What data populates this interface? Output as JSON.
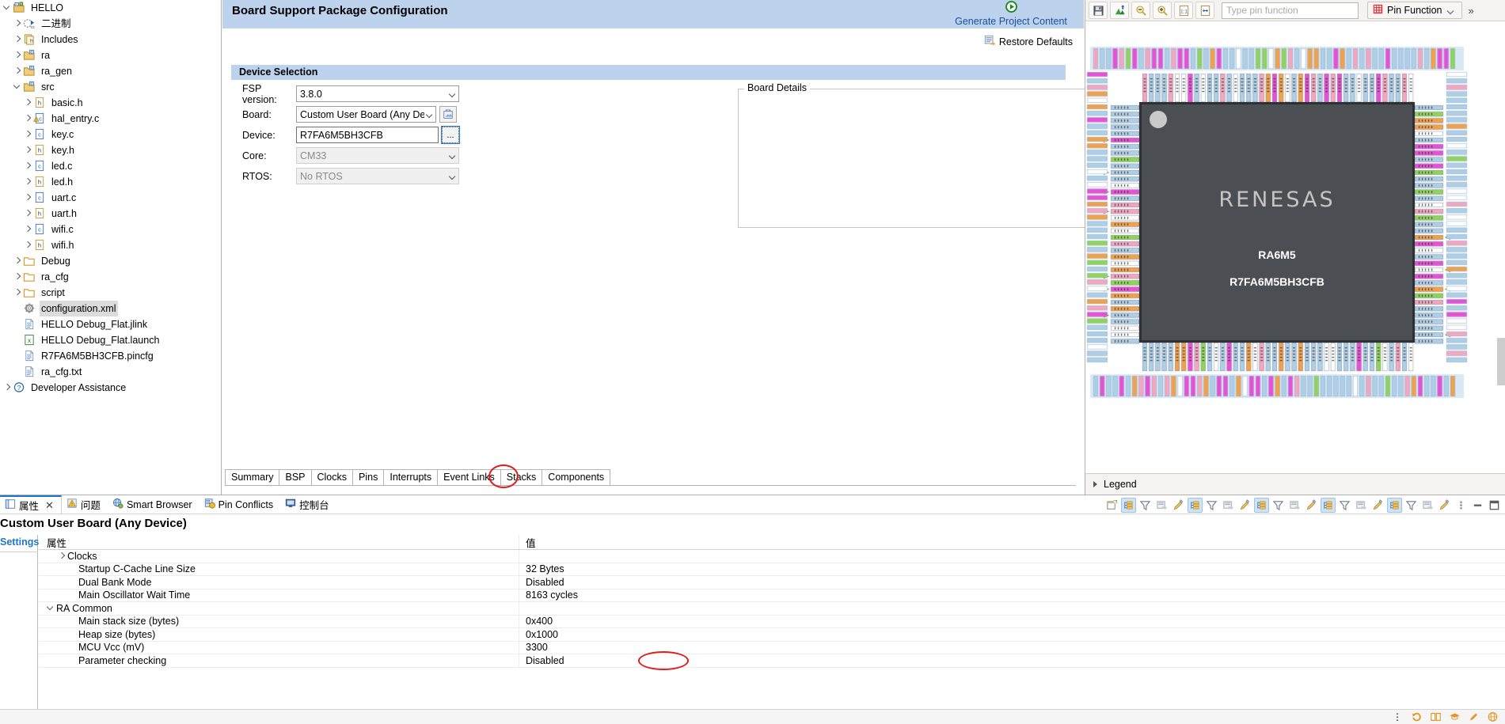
{
  "explorer": {
    "items": [
      {
        "label": "HELLO",
        "depth": 0,
        "arrow": "open",
        "icon": "project-icon",
        "selected": false
      },
      {
        "label": "二进制",
        "depth": 1,
        "arrow": "closed",
        "icon": "binaries-icon",
        "selected": false
      },
      {
        "label": "Includes",
        "depth": 1,
        "arrow": "closed",
        "icon": "includes-icon",
        "selected": false
      },
      {
        "label": "ra",
        "depth": 1,
        "arrow": "closed",
        "icon": "source-folder-icon",
        "selected": false
      },
      {
        "label": "ra_gen",
        "depth": 1,
        "arrow": "closed",
        "icon": "source-folder-icon",
        "selected": false
      },
      {
        "label": "src",
        "depth": 1,
        "arrow": "open",
        "icon": "source-folder-icon",
        "selected": false
      },
      {
        "label": "basic.h",
        "depth": 2,
        "arrow": "closed",
        "icon": "header-file-icon",
        "selected": false
      },
      {
        "label": "hal_entry.c",
        "depth": 2,
        "arrow": "closed",
        "icon": "c-file-warning-icon",
        "selected": false
      },
      {
        "label": "key.c",
        "depth": 2,
        "arrow": "closed",
        "icon": "c-file-icon",
        "selected": false
      },
      {
        "label": "key.h",
        "depth": 2,
        "arrow": "closed",
        "icon": "header-file-icon",
        "selected": false
      },
      {
        "label": "led.c",
        "depth": 2,
        "arrow": "closed",
        "icon": "c-file-icon",
        "selected": false
      },
      {
        "label": "led.h",
        "depth": 2,
        "arrow": "closed",
        "icon": "header-file-icon",
        "selected": false
      },
      {
        "label": "uart.c",
        "depth": 2,
        "arrow": "closed",
        "icon": "c-file-icon",
        "selected": false
      },
      {
        "label": "uart.h",
        "depth": 2,
        "arrow": "closed",
        "icon": "header-file-icon",
        "selected": false
      },
      {
        "label": "wifi.c",
        "depth": 2,
        "arrow": "closed",
        "icon": "c-file-icon",
        "selected": false
      },
      {
        "label": "wifi.h",
        "depth": 2,
        "arrow": "closed",
        "icon": "header-file-icon",
        "selected": false
      },
      {
        "label": "Debug",
        "depth": 1,
        "arrow": "closed",
        "icon": "folder-icon",
        "selected": false
      },
      {
        "label": "ra_cfg",
        "depth": 1,
        "arrow": "closed",
        "icon": "folder-icon",
        "selected": false
      },
      {
        "label": "script",
        "depth": 1,
        "arrow": "closed",
        "icon": "folder-icon",
        "selected": false
      },
      {
        "label": "configuration.xml",
        "depth": 1,
        "arrow": "none",
        "icon": "gear-icon",
        "selected": true
      },
      {
        "label": "HELLO Debug_Flat.jlink",
        "depth": 1,
        "arrow": "none",
        "icon": "text-file-icon",
        "selected": false
      },
      {
        "label": "HELLO Debug_Flat.launch",
        "depth": 1,
        "arrow": "none",
        "icon": "launch-file-icon",
        "selected": false
      },
      {
        "label": "R7FA6M5BH3CFB.pincfg",
        "depth": 1,
        "arrow": "none",
        "icon": "text-file-icon",
        "selected": false
      },
      {
        "label": "ra_cfg.txt",
        "depth": 1,
        "arrow": "none",
        "icon": "text-file-icon",
        "selected": false
      },
      {
        "label": "Developer Assistance",
        "depth": 0,
        "arrow": "closed",
        "icon": "help-icon",
        "selected": false
      }
    ]
  },
  "editor": {
    "title": "Board Support Package Configuration",
    "generate_link": "Generate Project Content",
    "restore_defaults": "Restore Defaults",
    "device_selection_header": "Device Selection",
    "board_details_legend": "Board Details",
    "fields": {
      "fsp_label": "FSP version:",
      "fsp_value": "3.8.0",
      "board_label": "Board:",
      "board_value": "Custom User Board (Any Device)",
      "device_label": "Device:",
      "device_value": "R7FA6M5BH3CFB",
      "device_browse": "...",
      "core_label": "Core:",
      "core_value": "CM33",
      "rtos_label": "RTOS:",
      "rtos_value": "No RTOS"
    },
    "tabs": [
      {
        "label": "Summary",
        "active": false
      },
      {
        "label": "BSP",
        "active": true
      },
      {
        "label": "Clocks",
        "active": false
      },
      {
        "label": "Pins",
        "active": false
      },
      {
        "label": "Interrupts",
        "active": false
      },
      {
        "label": "Event Links",
        "active": false
      },
      {
        "label": "Stacks",
        "active": false
      },
      {
        "label": "Components",
        "active": false
      }
    ]
  },
  "pinview": {
    "toolbar_icons": [
      "save-icon",
      "export-image-icon",
      "zoom-out-icon",
      "zoom-in-icon",
      "zoom-actual-icon",
      "zoom-fit-icon"
    ],
    "search_placeholder": "Type pin function",
    "pin_function_label": "Pin Function",
    "more_label": "»",
    "chip": {
      "brand": "RENESAS",
      "family": "RA6M5",
      "part": "R7FA6M5BH3CFB"
    },
    "legend_label": "Legend"
  },
  "bottom": {
    "view_tabs": [
      {
        "label": "属性",
        "icon": "properties-icon",
        "active": true,
        "closable": true
      },
      {
        "label": "问题",
        "icon": "problems-icon",
        "active": false,
        "closable": false
      },
      {
        "label": "Smart Browser",
        "icon": "smart-browser-icon",
        "active": false,
        "closable": false
      },
      {
        "label": "Pin Conflicts",
        "icon": "pin-conflicts-icon",
        "active": false,
        "closable": false
      },
      {
        "label": "控制台",
        "icon": "console-icon",
        "active": false,
        "closable": false
      }
    ],
    "title": "Custom User Board (Any Device)",
    "settings_tab": "Settings",
    "columns": [
      "属性",
      "值"
    ],
    "rows": [
      {
        "name": "Clocks",
        "value": "",
        "indent": 1,
        "twisty": "right"
      },
      {
        "name": "Startup C-Cache Line Size",
        "value": "32 Bytes",
        "indent": 2,
        "twisty": "none"
      },
      {
        "name": "Dual Bank Mode",
        "value": "Disabled",
        "indent": 2,
        "twisty": "none"
      },
      {
        "name": "Main Oscillator Wait Time",
        "value": "8163 cycles",
        "indent": 2,
        "twisty": "none"
      },
      {
        "name": "RA Common",
        "value": "",
        "indent": 0,
        "twisty": "down"
      },
      {
        "name": "Main stack size (bytes)",
        "value": "0x400",
        "indent": 2,
        "twisty": "none",
        "highlighted": true
      },
      {
        "name": "Heap size (bytes)",
        "value": "0x1000",
        "indent": 2,
        "twisty": "none"
      },
      {
        "name": "MCU Vcc (mV)",
        "value": "3300",
        "indent": 2,
        "twisty": "none"
      },
      {
        "name": "Parameter checking",
        "value": "Disabled",
        "indent": 2,
        "twisty": "none"
      }
    ]
  },
  "colors": {
    "header_blue": "#bdd2ec",
    "link_blue": "#1a4f9c",
    "accent_blue": "#1d77c7",
    "annotation_red": "#e01b1b",
    "chip_body": "#4b4e52"
  }
}
